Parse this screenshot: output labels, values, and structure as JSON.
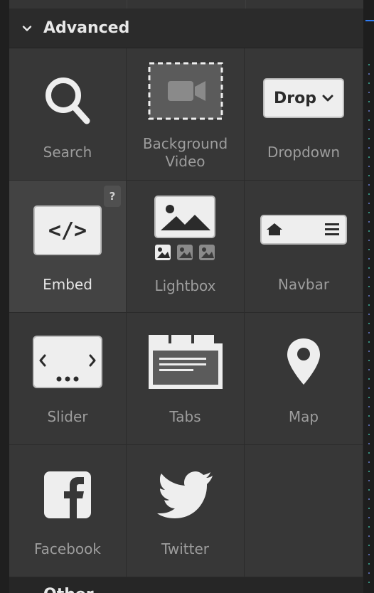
{
  "section": {
    "title": "Advanced",
    "collapse_icon": "chevron-down-icon"
  },
  "elements": [
    {
      "label": "Search",
      "icon": "search-icon"
    },
    {
      "label_line1": "Background",
      "label_line2": "Video",
      "icon": "background-video-icon"
    },
    {
      "label": "Dropdown",
      "icon": "dropdown-icon",
      "icon_text": "Drop"
    },
    {
      "label": "Embed",
      "icon": "embed-code-icon",
      "icon_text": "</>",
      "help": "?"
    },
    {
      "label": "Lightbox",
      "icon": "lightbox-icon"
    },
    {
      "label": "Navbar",
      "icon": "navbar-icon"
    },
    {
      "label": "Slider",
      "icon": "slider-icon"
    },
    {
      "label": "Tabs",
      "icon": "tabs-icon"
    },
    {
      "label": "Map",
      "icon": "map-pin-icon"
    },
    {
      "label": "Facebook",
      "icon": "facebook-icon"
    },
    {
      "label": "Twitter",
      "icon": "twitter-icon"
    }
  ],
  "next_section": {
    "title": "Other"
  },
  "colors": {
    "background": "#2b2b2b",
    "cell": "#373737",
    "cell_active": "#434343",
    "label": "#9d9d9d",
    "icon": "#eeeeee",
    "accent_blue": "#2f7cf6"
  }
}
